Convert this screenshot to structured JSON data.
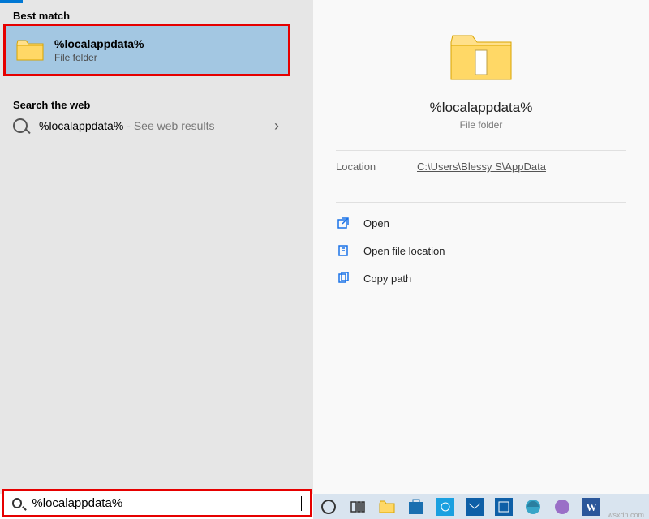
{
  "left": {
    "best_match_label": "Best match",
    "best_match": {
      "title": "%localappdata%",
      "subtitle": "File folder"
    },
    "search_web_label": "Search the web",
    "web_item": {
      "text": "%localappdata%",
      "hint": "- See web results",
      "chev": "›"
    }
  },
  "right": {
    "title": "%localappdata%",
    "subtitle": "File folder",
    "location_label": "Location",
    "location_value": "C:\\Users\\Blessy S\\AppData",
    "actions": {
      "open": "Open",
      "open_loc": "Open file location",
      "copy_path": "Copy path"
    }
  },
  "search": {
    "value": "%localappdata%"
  },
  "taskbar": {
    "items": [
      "cortana-circle",
      "task-view",
      "file-explorer",
      "store",
      "settings",
      "mail",
      "mail2",
      "edge",
      "more",
      "word"
    ]
  },
  "watermark": "wsxdn.com"
}
